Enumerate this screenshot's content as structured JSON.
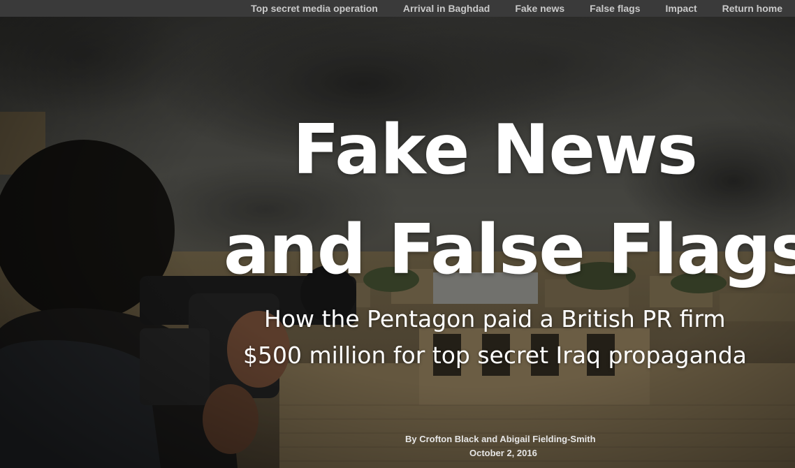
{
  "nav": {
    "items": [
      {
        "label": "Top secret media operation"
      },
      {
        "label": "Arrival in Baghdad"
      },
      {
        "label": "Fake news"
      },
      {
        "label": "False flags"
      },
      {
        "label": "Impact"
      },
      {
        "label": "Return home"
      }
    ]
  },
  "hero": {
    "title_line_1": "Fake News",
    "title_line_2": "and False Flags",
    "subtitle_line_1": "How the Pentagon paid a British PR firm",
    "subtitle_line_2": "$500 million for top secret Iraq propaganda",
    "authors": "By Crofton Black and Abigail Fielding-Smith",
    "date": "October 2, 2016"
  },
  "colors": {
    "nav_background": "#3a3a3a",
    "nav_text": "#c9c9c9",
    "title_text": "#ffffff"
  }
}
